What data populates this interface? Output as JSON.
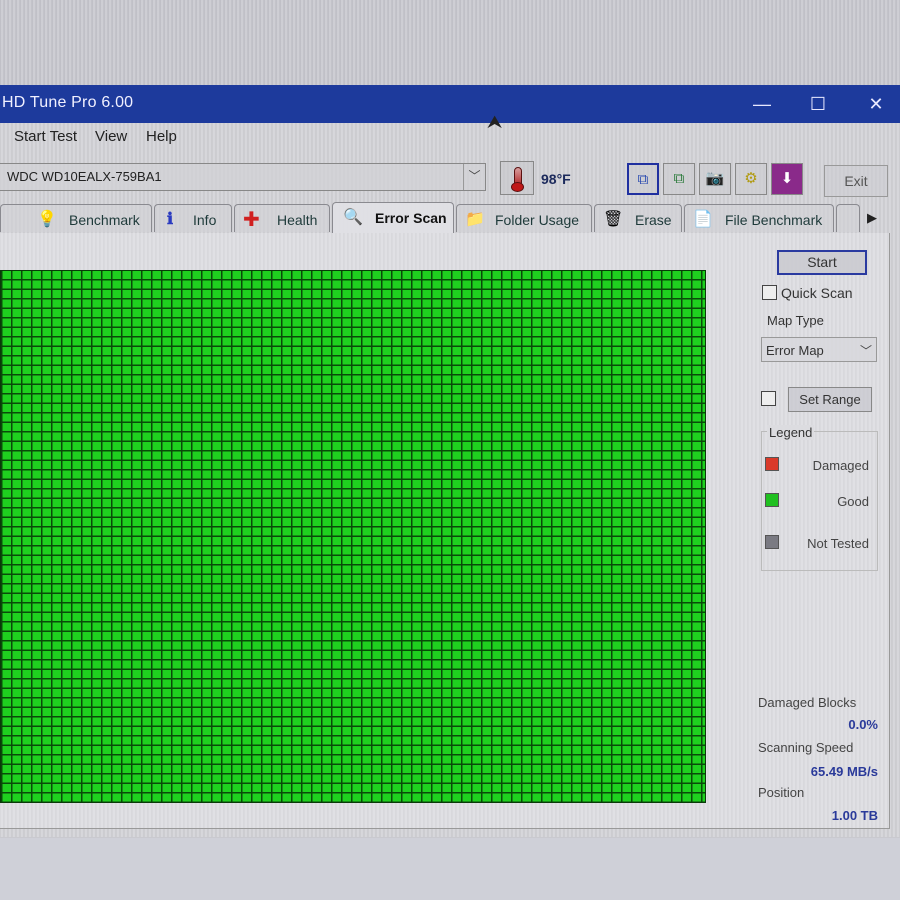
{
  "window": {
    "title": "HD Tune Pro 6.00",
    "controls": {
      "minimize": "—",
      "maximize": "☐",
      "close": "✕"
    }
  },
  "menu": [
    "Start Test",
    "View",
    "Help"
  ],
  "drive": {
    "selected": "WDC WD10EALX-759BA1",
    "temperature": "98°F"
  },
  "toolbar": {
    "buttons": [
      {
        "name": "copy-text-icon",
        "glyph": "⧉",
        "active": true
      },
      {
        "name": "copy-screenshot-icon",
        "glyph": "⧉"
      },
      {
        "name": "camera-icon",
        "glyph": "📷"
      },
      {
        "name": "options-coins-icon",
        "glyph": "⚙"
      },
      {
        "name": "save-download-icon",
        "glyph": "⬇"
      }
    ],
    "exit_label": "Exit"
  },
  "tabs": [
    {
      "label": "Benchmark",
      "icon": "💡"
    },
    {
      "label": "Info",
      "icon": "ℹ"
    },
    {
      "label": "Health",
      "icon": "✚"
    },
    {
      "label": "Error Scan",
      "icon": "🔍",
      "selected": true
    },
    {
      "label": "Folder Usage",
      "icon": "📁"
    },
    {
      "label": "Erase",
      "icon": "🗑"
    },
    {
      "label": "File Benchmark",
      "icon": "📄"
    }
  ],
  "tab_scroll": "▶",
  "error_scan": {
    "map_state": "all-good",
    "start_label": "Start",
    "quick_scan_label": "Quick Scan",
    "quick_scan_checked": false,
    "map_type_label": "Map Type",
    "map_type_value": "Error Map",
    "set_range_label": "Set Range",
    "set_range_checked": false,
    "legend": {
      "title": "Legend",
      "items": [
        {
          "label": "Damaged",
          "color": "#d93a2a"
        },
        {
          "label": "Good",
          "color": "#20c020"
        },
        {
          "label": "Not Tested",
          "color": "#7a7a82"
        }
      ]
    },
    "stats": {
      "damaged_blocks_label": "Damaged Blocks",
      "damaged_blocks_value": "0.0%",
      "scanning_speed_label": "Scanning Speed",
      "scanning_speed_value": "65.49 MB/s",
      "position_label": "Position",
      "position_value": "1.00 TB"
    }
  },
  "colors": {
    "titlebar": "#1d3a9c",
    "good_block": "#1fd01f",
    "stat_value": "#2a3a9a"
  }
}
